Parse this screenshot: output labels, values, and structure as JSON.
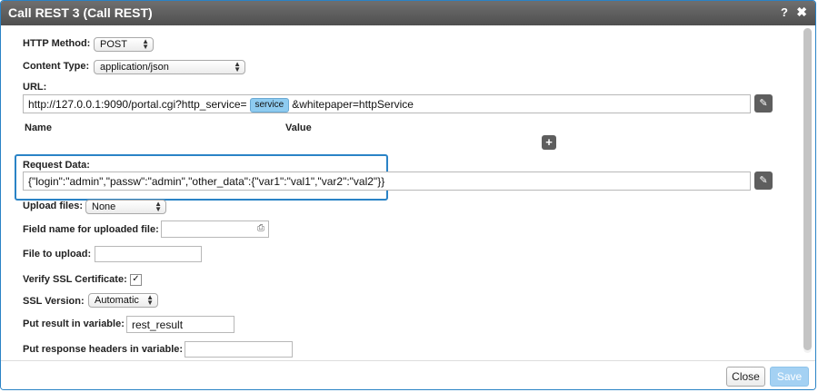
{
  "dialog": {
    "title": "Call REST 3 (Call REST)",
    "help_label": "?",
    "close_label": "✖"
  },
  "http_method": {
    "label": "HTTP Method:",
    "value": "POST"
  },
  "content_type": {
    "label": "Content Type:",
    "value": "application/json"
  },
  "url": {
    "label": "URL:",
    "prefix": "http://127.0.0.1:9090/portal.cgi?http_service=",
    "tag": "service",
    "suffix": "&whitepaper=httpService"
  },
  "params_table": {
    "name_header": "Name",
    "value_header": "Value",
    "add_label": "+"
  },
  "request_data": {
    "label": "Request Data:",
    "value": "{\"login\":\"admin\",\"passw\":\"admin\",\"other_data\":{\"var1\":\"val1\",\"var2\":\"val2\"}}"
  },
  "upload_files": {
    "label": "Upload files:",
    "value": "None"
  },
  "field_name_uploaded": {
    "label": "Field name for uploaded file:",
    "value": ""
  },
  "file_to_upload": {
    "label": "File to upload:",
    "value": ""
  },
  "verify_ssl": {
    "label": "Verify SSL Certificate:",
    "checked": true,
    "check_glyph": "✓"
  },
  "ssl_version": {
    "label": "SSL Version:",
    "value": "Automatic"
  },
  "result_var": {
    "label": "Put result in variable:",
    "value": "rest_result"
  },
  "headers_var": {
    "label": "Put response headers in variable:",
    "value": ""
  },
  "footer": {
    "close_label": "Close",
    "save_label": "Save"
  },
  "colors": {
    "accent": "#2a83c6",
    "titlebar": "#5a5a5a",
    "tag": "#8ecbf0",
    "save": "#a4d1f3"
  }
}
